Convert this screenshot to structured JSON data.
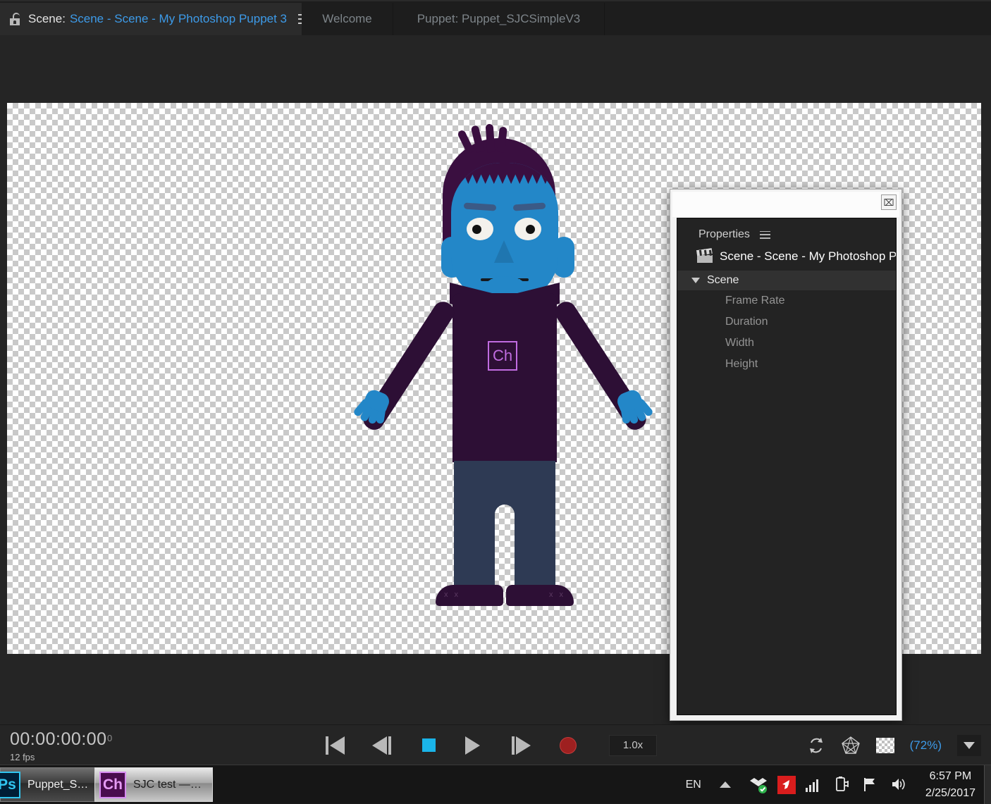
{
  "app": {
    "titlebar": {
      "lock_icon": "unlocked-padlock-icon",
      "scene_prefix": "Scene:",
      "scene_name": "Scene - Scene - My Photoshop Puppet 3",
      "menu_icon": "hamburger-menu-icon",
      "tabs": [
        {
          "id": "welcome",
          "label": "Welcome",
          "active": false
        },
        {
          "id": "puppet",
          "label": "Puppet: Puppet_SJCSimpleV3",
          "active": false
        }
      ]
    }
  },
  "stage": {
    "canvas_background": "transparency-checkerboard",
    "puppet": {
      "name": "My Photoshop Puppet 3",
      "chest_badge": "Ch",
      "colors": {
        "skin": "#2387c8",
        "skin_shade": "#1f76b0",
        "hair": "#3a0f40",
        "shirt": "#2d0f35",
        "pants": "#2e3a54",
        "shoes": "#2d0f35",
        "eye_white": "#f3f1ec",
        "pupil": "#111111",
        "brow": "#3b5a86",
        "badge": "#c06ce0"
      },
      "shoe_lace_mark": "x x"
    }
  },
  "properties_window": {
    "close_label": "⌧",
    "panel_title": "Properties",
    "panel_menu_icon": "hamburger-menu-icon",
    "item_icon": "clapperboard-icon",
    "item_title": "Scene - Scene - My Photoshop P",
    "group": {
      "label": "Scene",
      "expanded": true,
      "rows": [
        {
          "label": "Frame Rate"
        },
        {
          "label": "Duration"
        },
        {
          "label": "Width"
        },
        {
          "label": "Height"
        }
      ]
    }
  },
  "transport": {
    "timecode": "00:00:00:00",
    "frame_number": "0",
    "fps": "12 fps",
    "buttons": [
      {
        "id": "go-to-start",
        "icon": "skip-to-start-icon"
      },
      {
        "id": "step-back",
        "icon": "step-backward-icon"
      },
      {
        "id": "stop",
        "icon": "stop-square-icon",
        "color": "#1ab4e8"
      },
      {
        "id": "play",
        "icon": "play-triangle-icon"
      },
      {
        "id": "step-forward",
        "icon": "step-forward-icon"
      },
      {
        "id": "record",
        "icon": "record-circle-icon",
        "color": "#9e2020"
      }
    ],
    "speed": "1.0x",
    "view_tools": [
      {
        "id": "refresh",
        "icon": "refresh-icon"
      },
      {
        "id": "mesh",
        "icon": "mesh-polygon-icon"
      },
      {
        "id": "transparency",
        "icon": "transparency-grid-icon"
      }
    ],
    "zoom_level": "(72%)",
    "zoom_caret": "chevron-down-icon"
  },
  "taskbar": {
    "buttons": [
      {
        "id": "photoshop",
        "icon_text": "Ps",
        "label": "Puppet_S…",
        "active": false
      },
      {
        "id": "character-animator",
        "icon_text": "Ch",
        "label": "SJC test —…",
        "active": true
      }
    ],
    "tray": {
      "language": "EN",
      "chevron": "show-hidden-icons-chevron",
      "icons": [
        {
          "id": "dropbox",
          "name": "dropbox-icon"
        },
        {
          "id": "nvidia",
          "name": "red-cursor-icon"
        },
        {
          "id": "signal",
          "name": "signal-bars-icon"
        },
        {
          "id": "battery",
          "name": "battery-plug-icon"
        },
        {
          "id": "action-center",
          "name": "flag-icon"
        },
        {
          "id": "volume",
          "name": "speaker-icon"
        }
      ],
      "time": "6:57 PM",
      "date": "2/25/2017"
    }
  }
}
